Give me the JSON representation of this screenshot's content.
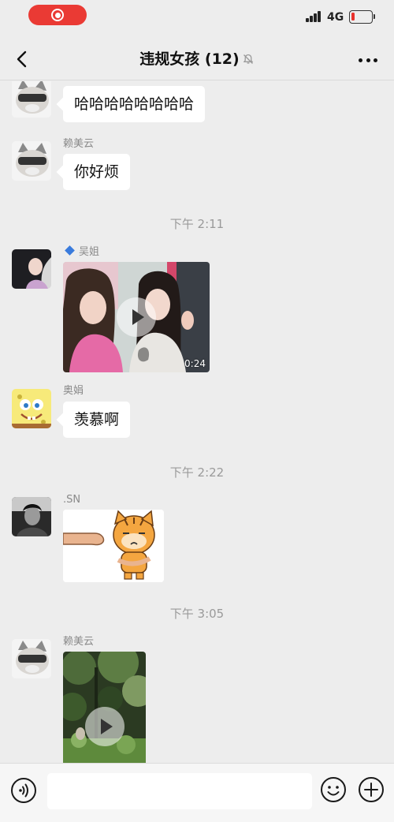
{
  "status": {
    "network": "4G",
    "battery_level": 0.18
  },
  "header": {
    "title": "违规女孩 (12)"
  },
  "messages": {
    "m1_text": "哈哈哈哈哈哈哈哈",
    "m2_sender": "赖美云",
    "m2_text": "你好烦",
    "time1": "下午 2:11",
    "m3_sender": "吴姐",
    "m3_duration": "0:24",
    "m4_sender": "奥娟",
    "m4_text": "羡慕啊",
    "time2": "下午 2:22",
    "m5_sender": ".SN",
    "time3": "下午 3:05",
    "m6_sender": "赖美云"
  },
  "icons": {
    "back": "chevron-left-icon",
    "mute": "bell-off-icon",
    "more": "more-dots-icon",
    "voice": "voice-icon",
    "emoji": "emoji-icon",
    "plus": "plus-icon",
    "play": "play-icon"
  },
  "colors": {
    "record_pill": "#ea3a34",
    "battery_low": "#e8312c",
    "chat_bg": "#ededed"
  }
}
